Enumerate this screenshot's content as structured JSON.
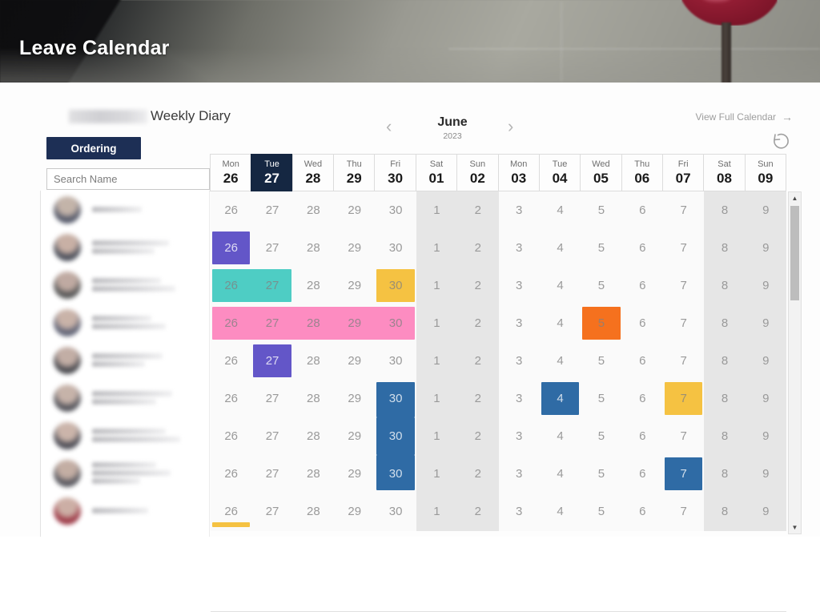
{
  "banner": {
    "title": "Leave Calendar",
    "photo_description": "blurred office photo with dark red lamp"
  },
  "header": {
    "diary_title": "Weekly Diary",
    "company_redacted": true,
    "ordering_label": "Ordering",
    "search_placeholder": "Search Name",
    "search_value": "",
    "view_full_calendar": "View Full Calendar",
    "view_full_arrow": "→",
    "refresh_icon": "refresh-icon",
    "prev_arrow": "‹",
    "next_arrow": "›"
  },
  "calendar": {
    "month": "June",
    "year": "2023",
    "today_index": 1,
    "days": [
      {
        "dow": "Mon",
        "num": "26",
        "short": "26",
        "weekend": false
      },
      {
        "dow": "Tue",
        "num": "27",
        "short": "27",
        "weekend": false
      },
      {
        "dow": "Wed",
        "num": "28",
        "short": "28",
        "weekend": false
      },
      {
        "dow": "Thu",
        "num": "29",
        "short": "29",
        "weekend": false
      },
      {
        "dow": "Fri",
        "num": "30",
        "short": "30",
        "weekend": false
      },
      {
        "dow": "Sat",
        "num": "01",
        "short": "1",
        "weekend": true
      },
      {
        "dow": "Sun",
        "num": "02",
        "short": "2",
        "weekend": true
      },
      {
        "dow": "Mon",
        "num": "03",
        "short": "3",
        "weekend": false
      },
      {
        "dow": "Tue",
        "num": "04",
        "short": "4",
        "weekend": false
      },
      {
        "dow": "Wed",
        "num": "05",
        "short": "5",
        "weekend": false
      },
      {
        "dow": "Thu",
        "num": "06",
        "short": "6",
        "weekend": false
      },
      {
        "dow": "Fri",
        "num": "07",
        "short": "7",
        "weekend": false
      },
      {
        "dow": "Sat",
        "num": "08",
        "short": "8",
        "weekend": true
      },
      {
        "dow": "Sun",
        "num": "09",
        "short": "9",
        "weekend": true
      }
    ]
  },
  "colors": {
    "navy": "#152742",
    "purple": "#6356c8",
    "teal": "#4ecdc4",
    "pink": "#fd8cc1",
    "yellow": "#f5c242",
    "orange": "#f5711e",
    "blue": "#2f6ba5",
    "weekend_shade": "#e6e6e6",
    "grid_text": "#9a9a9a"
  },
  "people": [
    {
      "name_redacted": true,
      "lines": [
        62
      ]
    },
    {
      "name_redacted": true,
      "lines": [
        96,
        78
      ]
    },
    {
      "name_redacted": true,
      "lines": [
        86,
        104
      ]
    },
    {
      "name_redacted": true,
      "lines": [
        74,
        92
      ]
    },
    {
      "name_redacted": true,
      "lines": [
        88,
        66
      ]
    },
    {
      "name_redacted": true,
      "lines": [
        100,
        80
      ]
    },
    {
      "name_redacted": true,
      "lines": [
        92,
        110
      ]
    },
    {
      "name_redacted": true,
      "lines": [
        80,
        98,
        60
      ]
    },
    {
      "name_redacted": true,
      "lines": [
        70
      ]
    }
  ],
  "leave_blocks": [
    {
      "row": 1,
      "col": 0,
      "color": "purple"
    },
    {
      "row": 2,
      "col": 0,
      "color": "teal",
      "merge_right": true
    },
    {
      "row": 2,
      "col": 1,
      "color": "teal",
      "merge_left": true
    },
    {
      "row": 2,
      "col": 4,
      "color": "yellow"
    },
    {
      "row": 3,
      "col": 0,
      "color": "pink",
      "merge_right": true
    },
    {
      "row": 3,
      "col": 1,
      "color": "pink",
      "merge_left": true,
      "merge_right": true
    },
    {
      "row": 3,
      "col": 2,
      "color": "pink",
      "merge_left": true,
      "merge_right": true
    },
    {
      "row": 3,
      "col": 3,
      "color": "pink",
      "merge_left": true,
      "merge_right": true
    },
    {
      "row": 3,
      "col": 4,
      "color": "pink",
      "merge_left": true
    },
    {
      "row": 3,
      "col": 9,
      "color": "orange"
    },
    {
      "row": 4,
      "col": 1,
      "color": "purple"
    },
    {
      "row": 5,
      "col": 4,
      "color": "blue",
      "merge_bottom": true
    },
    {
      "row": 5,
      "col": 8,
      "color": "blue"
    },
    {
      "row": 5,
      "col": 11,
      "color": "yellow"
    },
    {
      "row": 6,
      "col": 4,
      "color": "blue",
      "merge_top": true,
      "merge_bottom": true
    },
    {
      "row": 7,
      "col": 4,
      "color": "blue",
      "merge_top": true
    },
    {
      "row": 7,
      "col": 11,
      "color": "blue"
    }
  ],
  "scrollbar": {
    "up_arrow": "▲",
    "down_arrow": "▼",
    "thumb_position": "top"
  }
}
